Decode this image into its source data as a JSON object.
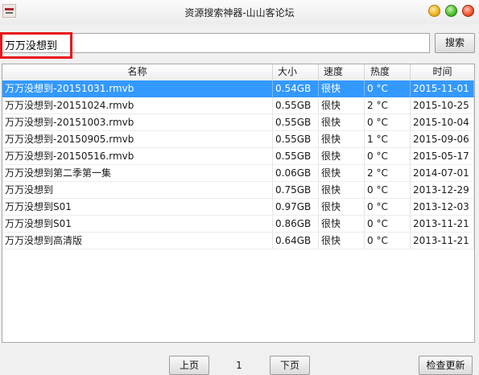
{
  "window": {
    "title": "资源搜索神器-山山客论坛"
  },
  "search": {
    "value": "万万没想到",
    "button_label": "搜索"
  },
  "table": {
    "columns": [
      "名称",
      "大小",
      "速度",
      "热度",
      "时间"
    ],
    "rows": [
      {
        "name": "万万没想到-20151031.rmvb",
        "size": "0.54GB",
        "speed": "很快",
        "heat": "0 °C",
        "time": "2015-11-01",
        "selected": true
      },
      {
        "name": "万万没想到-20151024.rmvb",
        "size": "0.55GB",
        "speed": "很快",
        "heat": "2 °C",
        "time": "2015-10-25"
      },
      {
        "name": "万万没想到-20151003.rmvb",
        "size": "0.55GB",
        "speed": "很快",
        "heat": "0 °C",
        "time": "2015-10-04"
      },
      {
        "name": "万万没想到-20150905.rmvb",
        "size": "0.55GB",
        "speed": "很快",
        "heat": "1 °C",
        "time": "2015-09-06"
      },
      {
        "name": "万万没想到-20150516.rmvb",
        "size": "0.55GB",
        "speed": "很快",
        "heat": "0 °C",
        "time": "2015-05-17"
      },
      {
        "name": "万万没想到第二季第一集",
        "size": "0.06GB",
        "speed": "很快",
        "heat": "2 °C",
        "time": "2014-07-01"
      },
      {
        "name": "万万没想到",
        "size": "0.75GB",
        "speed": "很快",
        "heat": "0 °C",
        "time": "2013-12-29"
      },
      {
        "name": "万万没想到S01",
        "size": "0.97GB",
        "speed": "很快",
        "heat": "0 °C",
        "time": "2013-12-03"
      },
      {
        "name": "万万没想到S01",
        "size": "0.86GB",
        "speed": "很快",
        "heat": "0 °C",
        "time": "2013-11-21"
      },
      {
        "name": "万万没想到高清版",
        "size": "0.64GB",
        "speed": "很快",
        "heat": "0 °C",
        "time": "2013-11-21"
      }
    ]
  },
  "pager": {
    "prev_label": "上页",
    "page": "1",
    "next_label": "下页"
  },
  "update_label": "检查更新",
  "colors": {
    "selection": "#3399ff",
    "highlight_border": "#e8161b"
  }
}
